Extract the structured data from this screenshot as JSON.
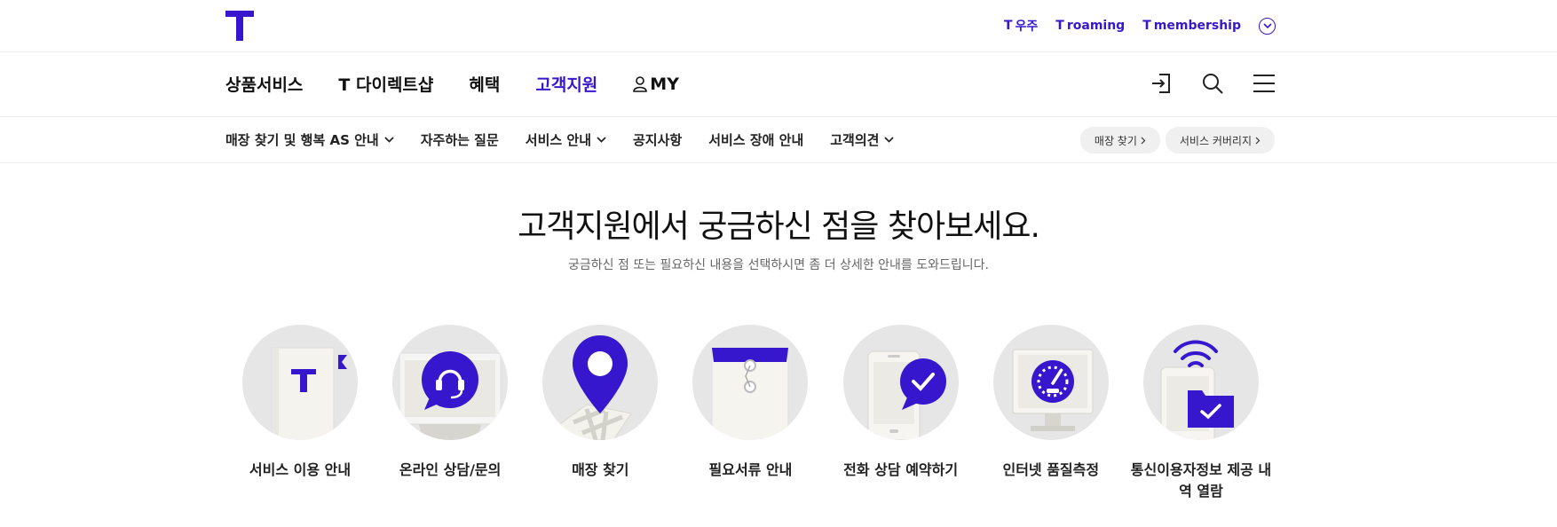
{
  "top_links": [
    {
      "mark": "T",
      "label": "우주"
    },
    {
      "mark": "T",
      "label": "roaming"
    },
    {
      "mark": "T",
      "label": "membership"
    }
  ],
  "gnb": [
    {
      "label": "상품서비스"
    },
    {
      "label": "T 다이렉트샵"
    },
    {
      "label": "혜택"
    },
    {
      "label": "고객지원"
    },
    {
      "label": "MY"
    }
  ],
  "lnb": [
    {
      "label": "매장 찾기 및 행복 AS 안내"
    },
    {
      "label": "자주하는 질문"
    },
    {
      "label": "서비스 안내"
    },
    {
      "label": "공지사항"
    },
    {
      "label": "서비스 장애 안내"
    },
    {
      "label": "고객의견"
    }
  ],
  "pills": [
    {
      "label": "매장 찾기"
    },
    {
      "label": "서비스 커버리지"
    }
  ],
  "hero": {
    "title": "고객지원에서 궁금하신 점을 찾아보세요.",
    "subtitle": "궁금하신 점 또는 필요하신 내용을 선택하시면 좀 더 상세한 안내를 도와드립니다."
  },
  "services": [
    {
      "label": "서비스 이용 안내",
      "icon": "guide-book-icon"
    },
    {
      "label": "온라인 상담/문의",
      "icon": "headset-chat-icon"
    },
    {
      "label": "매장 찾기",
      "icon": "map-pin-icon"
    },
    {
      "label": "필요서류 안내",
      "icon": "document-envelope-icon"
    },
    {
      "label": "전화 상담 예약하기",
      "icon": "phone-check-icon"
    },
    {
      "label": "인터넷 품질측정",
      "icon": "speedometer-monitor-icon"
    },
    {
      "label": "통신이용자정보 제공 내역 열람",
      "icon": "wifi-folder-icon"
    }
  ],
  "colors": {
    "brand": "#3617ce",
    "circle": "#e6e6e6"
  }
}
